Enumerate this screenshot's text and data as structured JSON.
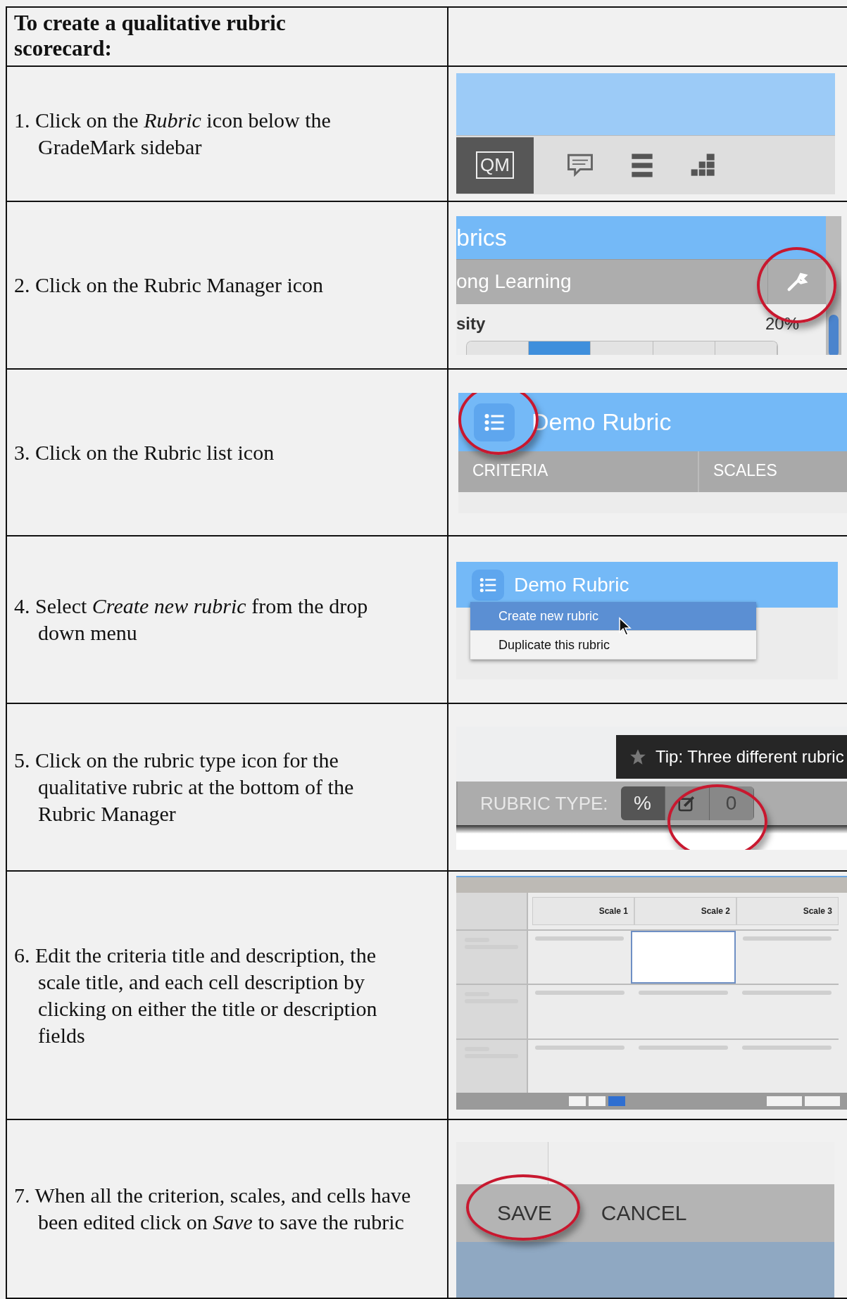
{
  "header": {
    "title": "To create a qualitative rubric scorecard:"
  },
  "steps": [
    {
      "text": "1. Click on the *Rubric* icon below the GradeMark sidebar",
      "shot": {
        "kind": "toolbar",
        "button": "QM"
      }
    },
    {
      "text": "2. Click on the Rubric Manager icon",
      "shot": {
        "kind": "manager",
        "heading": "brics",
        "rubric": "ong Learning",
        "criterion": "sity",
        "weight": "20%",
        "segments": [
          {
            "selected": false
          },
          {
            "selected": true
          },
          {
            "selected": false
          },
          {
            "selected": false
          },
          {
            "selected": false
          }
        ]
      }
    },
    {
      "text": "3. Click on the Rubric list icon",
      "shot": {
        "kind": "header",
        "title": "Demo Rubric",
        "columns": [
          "CRITERIA",
          "SCALES"
        ]
      }
    },
    {
      "text": "4. Select *Create new rubric* from the drop down menu",
      "shot": {
        "kind": "menu",
        "title": "Demo Rubric",
        "items": [
          {
            "label": "Create new rubric",
            "selected": true
          },
          {
            "label": "Duplicate this rubric",
            "selected": false
          }
        ]
      }
    },
    {
      "text": "5. Click on the rubric type icon for the qualitative rubric at the bottom of the Rubric Manager",
      "shot": {
        "kind": "type",
        "tip": "Tip: Three different rubric",
        "label": "RUBRIC TYPE:",
        "options": [
          {
            "kind": "text",
            "label": "%",
            "selected": true
          },
          {
            "kind": "edit",
            "selected": false
          },
          {
            "kind": "text",
            "label": "0",
            "selected": false
          }
        ]
      }
    },
    {
      "text": "6. Edit the criteria title and description, the scale title, and each cell description by clicking on either the title or description fields",
      "shot": {
        "kind": "editor",
        "scales": [
          "Scale 1",
          "Scale 2",
          "Scale 3"
        ]
      }
    },
    {
      "text": "7. When all the criterion, scales, and cells have been edited click on *Save* to save the rubric",
      "shot": {
        "kind": "actions",
        "buttons": [
          "SAVE",
          "CANCEL"
        ]
      }
    }
  ]
}
